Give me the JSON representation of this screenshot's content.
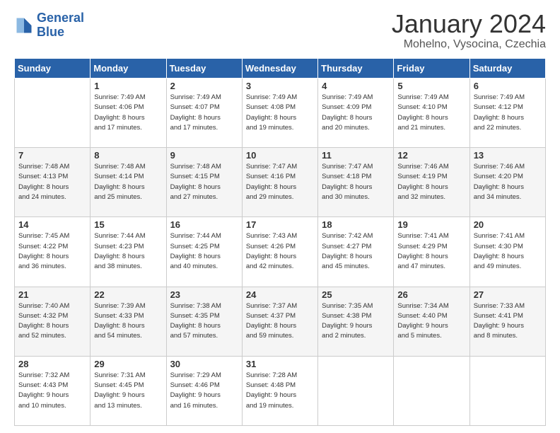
{
  "logo": {
    "line1": "General",
    "line2": "Blue"
  },
  "title": "January 2024",
  "location": "Mohelno, Vysocina, Czechia",
  "days_header": [
    "Sunday",
    "Monday",
    "Tuesday",
    "Wednesday",
    "Thursday",
    "Friday",
    "Saturday"
  ],
  "weeks": [
    [
      {
        "day": "",
        "sunrise": "",
        "sunset": "",
        "daylight": ""
      },
      {
        "day": "1",
        "sunrise": "Sunrise: 7:49 AM",
        "sunset": "Sunset: 4:06 PM",
        "daylight": "Daylight: 8 hours and 17 minutes."
      },
      {
        "day": "2",
        "sunrise": "Sunrise: 7:49 AM",
        "sunset": "Sunset: 4:07 PM",
        "daylight": "Daylight: 8 hours and 17 minutes."
      },
      {
        "day": "3",
        "sunrise": "Sunrise: 7:49 AM",
        "sunset": "Sunset: 4:08 PM",
        "daylight": "Daylight: 8 hours and 19 minutes."
      },
      {
        "day": "4",
        "sunrise": "Sunrise: 7:49 AM",
        "sunset": "Sunset: 4:09 PM",
        "daylight": "Daylight: 8 hours and 20 minutes."
      },
      {
        "day": "5",
        "sunrise": "Sunrise: 7:49 AM",
        "sunset": "Sunset: 4:10 PM",
        "daylight": "Daylight: 8 hours and 21 minutes."
      },
      {
        "day": "6",
        "sunrise": "Sunrise: 7:49 AM",
        "sunset": "Sunset: 4:12 PM",
        "daylight": "Daylight: 8 hours and 22 minutes."
      }
    ],
    [
      {
        "day": "7",
        "sunrise": "Sunrise: 7:48 AM",
        "sunset": "Sunset: 4:13 PM",
        "daylight": "Daylight: 8 hours and 24 minutes."
      },
      {
        "day": "8",
        "sunrise": "Sunrise: 7:48 AM",
        "sunset": "Sunset: 4:14 PM",
        "daylight": "Daylight: 8 hours and 25 minutes."
      },
      {
        "day": "9",
        "sunrise": "Sunrise: 7:48 AM",
        "sunset": "Sunset: 4:15 PM",
        "daylight": "Daylight: 8 hours and 27 minutes."
      },
      {
        "day": "10",
        "sunrise": "Sunrise: 7:47 AM",
        "sunset": "Sunset: 4:16 PM",
        "daylight": "Daylight: 8 hours and 29 minutes."
      },
      {
        "day": "11",
        "sunrise": "Sunrise: 7:47 AM",
        "sunset": "Sunset: 4:18 PM",
        "daylight": "Daylight: 8 hours and 30 minutes."
      },
      {
        "day": "12",
        "sunrise": "Sunrise: 7:46 AM",
        "sunset": "Sunset: 4:19 PM",
        "daylight": "Daylight: 8 hours and 32 minutes."
      },
      {
        "day": "13",
        "sunrise": "Sunrise: 7:46 AM",
        "sunset": "Sunset: 4:20 PM",
        "daylight": "Daylight: 8 hours and 34 minutes."
      }
    ],
    [
      {
        "day": "14",
        "sunrise": "Sunrise: 7:45 AM",
        "sunset": "Sunset: 4:22 PM",
        "daylight": "Daylight: 8 hours and 36 minutes."
      },
      {
        "day": "15",
        "sunrise": "Sunrise: 7:44 AM",
        "sunset": "Sunset: 4:23 PM",
        "daylight": "Daylight: 8 hours and 38 minutes."
      },
      {
        "day": "16",
        "sunrise": "Sunrise: 7:44 AM",
        "sunset": "Sunset: 4:25 PM",
        "daylight": "Daylight: 8 hours and 40 minutes."
      },
      {
        "day": "17",
        "sunrise": "Sunrise: 7:43 AM",
        "sunset": "Sunset: 4:26 PM",
        "daylight": "Daylight: 8 hours and 42 minutes."
      },
      {
        "day": "18",
        "sunrise": "Sunrise: 7:42 AM",
        "sunset": "Sunset: 4:27 PM",
        "daylight": "Daylight: 8 hours and 45 minutes."
      },
      {
        "day": "19",
        "sunrise": "Sunrise: 7:41 AM",
        "sunset": "Sunset: 4:29 PM",
        "daylight": "Daylight: 8 hours and 47 minutes."
      },
      {
        "day": "20",
        "sunrise": "Sunrise: 7:41 AM",
        "sunset": "Sunset: 4:30 PM",
        "daylight": "Daylight: 8 hours and 49 minutes."
      }
    ],
    [
      {
        "day": "21",
        "sunrise": "Sunrise: 7:40 AM",
        "sunset": "Sunset: 4:32 PM",
        "daylight": "Daylight: 8 hours and 52 minutes."
      },
      {
        "day": "22",
        "sunrise": "Sunrise: 7:39 AM",
        "sunset": "Sunset: 4:33 PM",
        "daylight": "Daylight: 8 hours and 54 minutes."
      },
      {
        "day": "23",
        "sunrise": "Sunrise: 7:38 AM",
        "sunset": "Sunset: 4:35 PM",
        "daylight": "Daylight: 8 hours and 57 minutes."
      },
      {
        "day": "24",
        "sunrise": "Sunrise: 7:37 AM",
        "sunset": "Sunset: 4:37 PM",
        "daylight": "Daylight: 8 hours and 59 minutes."
      },
      {
        "day": "25",
        "sunrise": "Sunrise: 7:35 AM",
        "sunset": "Sunset: 4:38 PM",
        "daylight": "Daylight: 9 hours and 2 minutes."
      },
      {
        "day": "26",
        "sunrise": "Sunrise: 7:34 AM",
        "sunset": "Sunset: 4:40 PM",
        "daylight": "Daylight: 9 hours and 5 minutes."
      },
      {
        "day": "27",
        "sunrise": "Sunrise: 7:33 AM",
        "sunset": "Sunset: 4:41 PM",
        "daylight": "Daylight: 9 hours and 8 minutes."
      }
    ],
    [
      {
        "day": "28",
        "sunrise": "Sunrise: 7:32 AM",
        "sunset": "Sunset: 4:43 PM",
        "daylight": "Daylight: 9 hours and 10 minutes."
      },
      {
        "day": "29",
        "sunrise": "Sunrise: 7:31 AM",
        "sunset": "Sunset: 4:45 PM",
        "daylight": "Daylight: 9 hours and 13 minutes."
      },
      {
        "day": "30",
        "sunrise": "Sunrise: 7:29 AM",
        "sunset": "Sunset: 4:46 PM",
        "daylight": "Daylight: 9 hours and 16 minutes."
      },
      {
        "day": "31",
        "sunrise": "Sunrise: 7:28 AM",
        "sunset": "Sunset: 4:48 PM",
        "daylight": "Daylight: 9 hours and 19 minutes."
      },
      {
        "day": "",
        "sunrise": "",
        "sunset": "",
        "daylight": ""
      },
      {
        "day": "",
        "sunrise": "",
        "sunset": "",
        "daylight": ""
      },
      {
        "day": "",
        "sunrise": "",
        "sunset": "",
        "daylight": ""
      }
    ]
  ]
}
